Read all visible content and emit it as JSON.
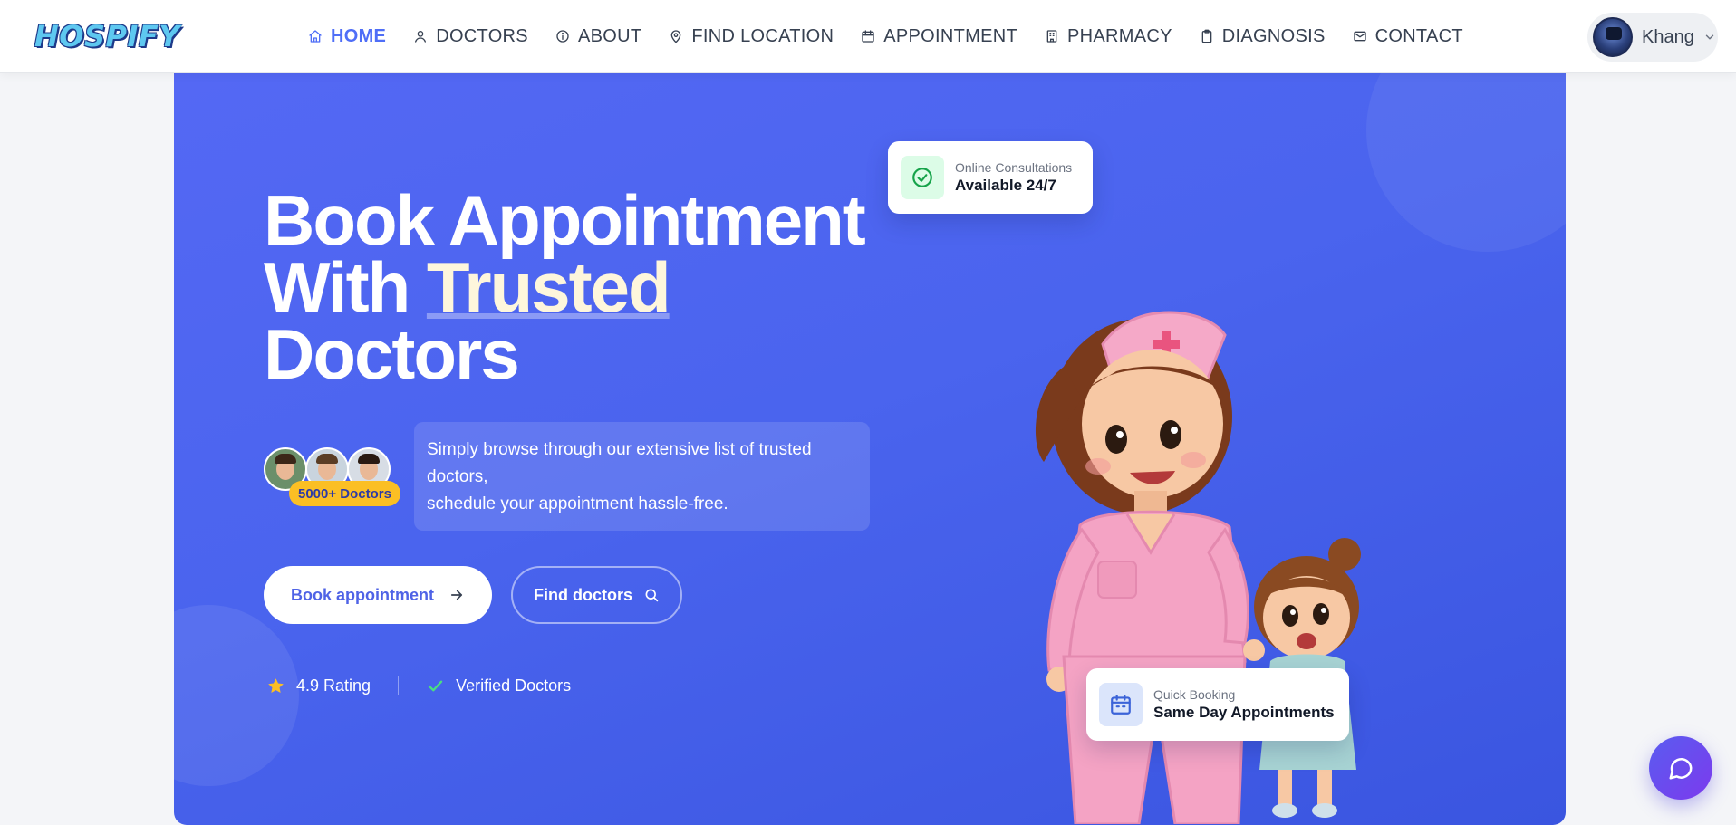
{
  "brand": {
    "logo_text": "HOSPIFY"
  },
  "nav": {
    "items": [
      {
        "label": "HOME",
        "icon": "home-icon",
        "active": true
      },
      {
        "label": "DOCTORS",
        "icon": "user-icon"
      },
      {
        "label": "ABOUT",
        "icon": "info-icon"
      },
      {
        "label": "FIND LOCATION",
        "icon": "map-pin-icon"
      },
      {
        "label": "APPOINTMENT",
        "icon": "calendar-icon"
      },
      {
        "label": "PHARMACY",
        "icon": "building-icon"
      },
      {
        "label": "DIAGNOSIS",
        "icon": "clipboard-icon"
      },
      {
        "label": "CONTACT",
        "icon": "mail-icon"
      }
    ]
  },
  "user": {
    "name": "Khang"
  },
  "hero": {
    "title_line1": "Book Appointment",
    "title_line2_prefix": "With ",
    "title_line2_highlight": "Trusted",
    "title_line3": "Doctors",
    "doctors_badge": "5000+ Doctors",
    "description_line1": "Simply browse through our extensive list of trusted doctors,",
    "description_line2": "schedule your appointment hassle-free.",
    "primary_button": "Book appointment",
    "secondary_button": "Find doctors",
    "rating_text": "4.9 Rating",
    "verified_text": "Verified Doctors"
  },
  "cards": {
    "online": {
      "label": "Online Consultations",
      "value": "Available 24/7"
    },
    "booking": {
      "label": "Quick Booking",
      "value": "Same Day Appointments"
    }
  },
  "colors": {
    "accent": "#4f6ef7",
    "hero_background": "#4a64ee",
    "badge": "#fbbf24",
    "chat_button": "#6d4bf0"
  },
  "icons": {
    "chat": "chat-bubble-icon",
    "star": "star-icon",
    "check": "check-icon",
    "arrow": "arrow-right-icon",
    "search": "search-icon"
  }
}
